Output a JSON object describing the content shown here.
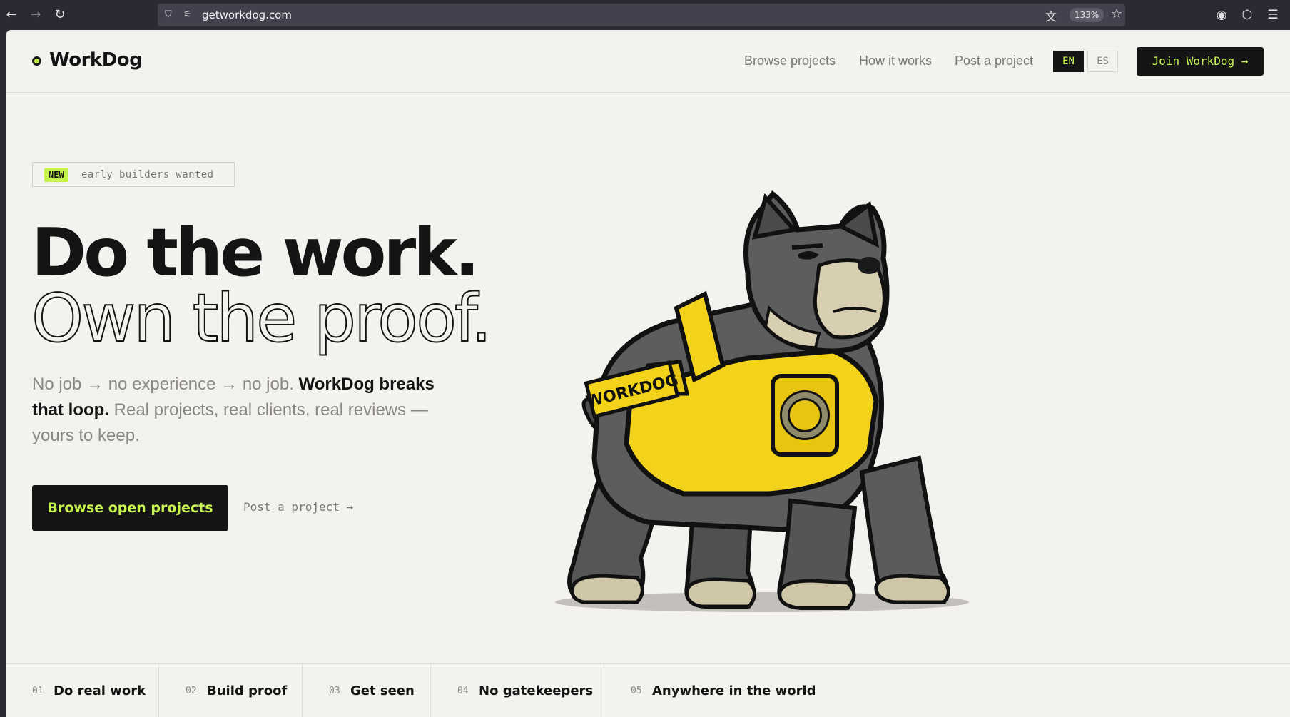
{
  "browser": {
    "url": "getworkdog.com",
    "zoom": "133%"
  },
  "header": {
    "logo": "WorkDog",
    "nav": [
      "Browse projects",
      "How it works",
      "Post a project"
    ],
    "languages": [
      "EN",
      "ES"
    ],
    "active_language": "EN",
    "join_label": "Join WorkDog →"
  },
  "hero": {
    "badge_new": "NEW",
    "badge_text": "early builders wanted",
    "headline_line1": "Do the work.",
    "headline_line2": "Own the proof.",
    "sub_muted_1": "No job → no experience → no job. ",
    "sub_strong": "WorkDog breaks that loop.",
    "sub_muted_2": " Real projects, real clients, real reviews — yours to keep.",
    "cta_primary": "Browse open projects",
    "cta_secondary": "Post a project →"
  },
  "illustration": {
    "vest_text": "WORKDOG"
  },
  "features": [
    {
      "num": "01",
      "title": "Do real work"
    },
    {
      "num": "02",
      "title": "Build proof"
    },
    {
      "num": "03",
      "title": "Get seen"
    },
    {
      "num": "04",
      "title": "No gatekeepers"
    },
    {
      "num": "05",
      "title": "Anywhere in the world"
    }
  ],
  "colors": {
    "accent": "#c6f24e",
    "ink": "#141414",
    "background": "#f3f2ee",
    "vest_yellow": "#f2d21a",
    "dog_gray": "#5a5c5c"
  }
}
